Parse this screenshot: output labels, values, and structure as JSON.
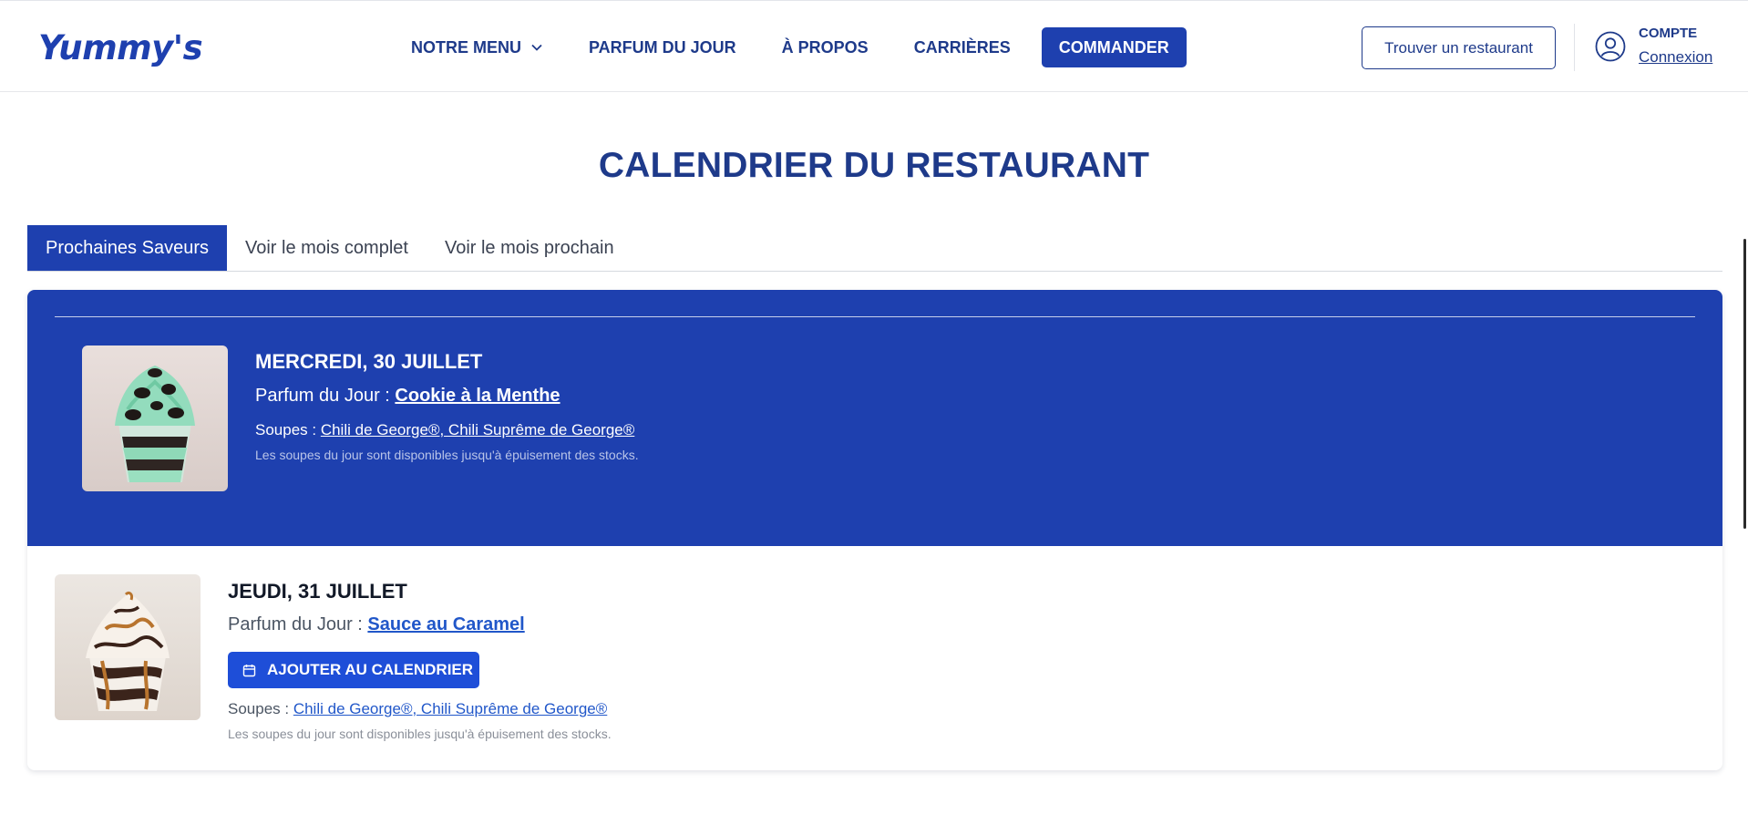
{
  "header": {
    "logo": "Yummy's",
    "nav": [
      {
        "label": "NOTRE MENU",
        "has_dropdown": true
      },
      {
        "label": "PARFUM DU JOUR"
      },
      {
        "label": "À PROPOS"
      },
      {
        "label": "CARRIÈRES"
      }
    ],
    "cta": "COMMANDER",
    "find_restaurant": "Trouver un restaurant",
    "account": {
      "label": "COMPTE",
      "link": "Connexion",
      "icon": "user-circle-icon"
    },
    "chevron_icon": "chevron-down-icon"
  },
  "page_title": "CALENDRIER DU RESTAURANT",
  "tabs": [
    {
      "label": "Prochaines Saveurs",
      "active": true
    },
    {
      "label": "Voir le mois complet",
      "active": false
    },
    {
      "label": "Voir le mois prochain",
      "active": false
    }
  ],
  "days": [
    {
      "date": "MERCREDI, 30 JUILLET",
      "flavor_prefix": "Parfum du Jour : ",
      "flavor": "Cookie à la Menthe",
      "soups_prefix": "Soupes : ",
      "soups": "Chili de George®, Chili Suprême de George®",
      "note": "Les soupes du jour sont disponibles jusqu'à épuisement des stocks.",
      "image": "mint-cookie-sundae"
    },
    {
      "date": "JEUDI, 31 JUILLET",
      "flavor_prefix": "Parfum du Jour : ",
      "flavor": "Sauce au Caramel",
      "add_calendar": "AJOUTER AU CALENDRIER",
      "calendar_icon": "calendar-icon",
      "soups_prefix": "Soupes : ",
      "soups": "Chili de George®, Chili Suprême de George®",
      "note": "Les soupes du jour sont disponibles jusqu'à épuisement des stocks.",
      "image": "caramel-sundae"
    }
  ],
  "colors": {
    "brand_blue": "#1e40af",
    "navy_text": "#1e3a8a",
    "link_blue": "#2157c9"
  }
}
